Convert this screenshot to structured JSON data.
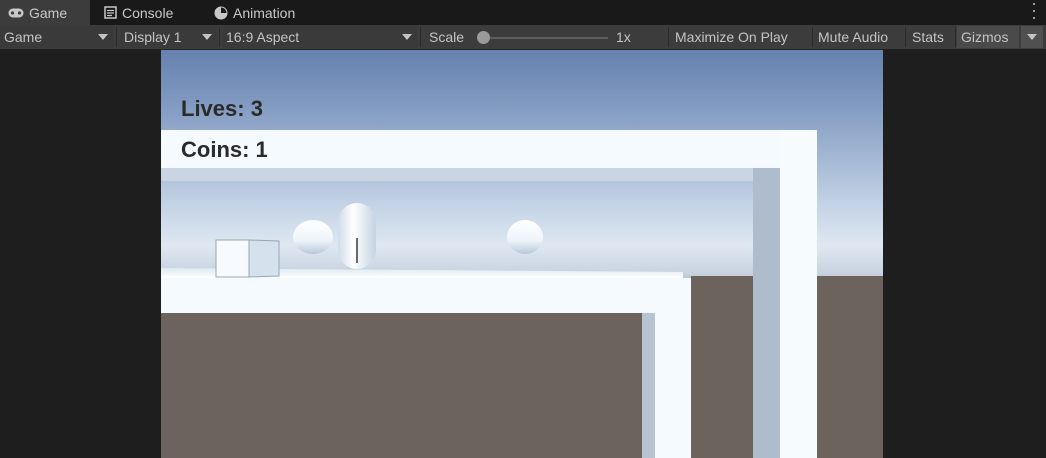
{
  "tabs": [
    {
      "label": "Game",
      "icon": "gamepad-icon",
      "active": true
    },
    {
      "label": "Console",
      "icon": "console-icon",
      "active": false
    },
    {
      "label": "Animation",
      "icon": "animation-icon",
      "active": false
    }
  ],
  "toolbar": {
    "game_view_select": "Game",
    "display_select": "Display 1",
    "aspect_select": "16:9 Aspect",
    "scale_label": "Scale",
    "scale_value": "1x",
    "scale_level": 0.0,
    "maximize_label": "Maximize On Play",
    "mute_label": "Mute Audio",
    "stats_label": "Stats",
    "gizmos_label": "Gizmos"
  },
  "hud": {
    "lives": "Lives: 3",
    "coins": "Coins: 1"
  },
  "colors": {
    "editor_bg": "#191919",
    "toolbar_bg": "#3c3c3c",
    "hud_text": "#2a2a2a",
    "wall": "#f4fafd",
    "ground": "#6b635c"
  }
}
